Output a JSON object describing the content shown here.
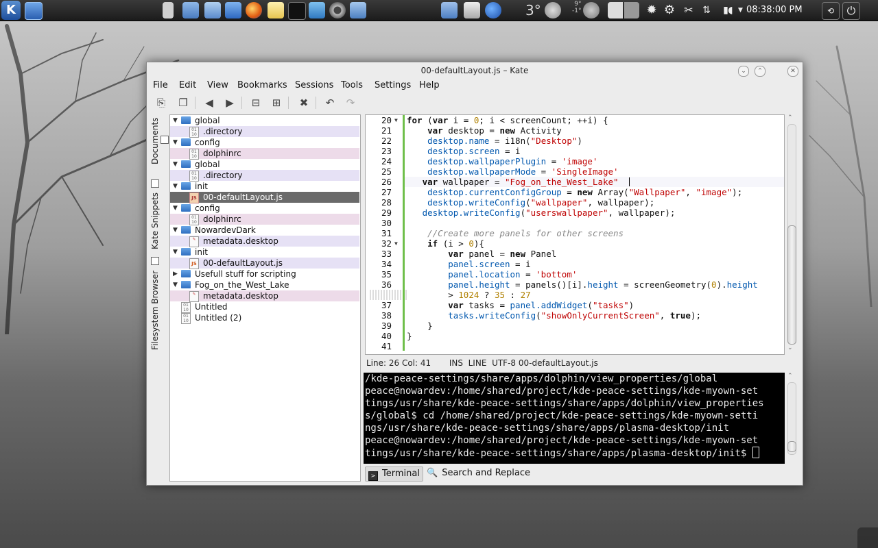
{
  "panel": {
    "clock": "08:38:00 PM",
    "weather_temp": "3°",
    "weather_high": "9°",
    "weather_low": "-1°",
    "launcher_icons": [
      "kde-menu-icon",
      "desktop-icon",
      "clipboard-icon",
      "bookmarks-icon",
      "search-icon",
      "dolphin-icon",
      "firefox-icon",
      "notes-icon",
      "konsole-icon",
      "kate-icon",
      "camera-icon",
      "settings-icon"
    ]
  },
  "window": {
    "title": "00-defaultLayout.js – Kate",
    "menus": [
      "File",
      "Edit",
      "View",
      "Bookmarks",
      "Sessions",
      "Tools",
      "Settings",
      "Help"
    ]
  },
  "side_tabs": [
    "Documents",
    "Kate Snippets",
    "Filesystem Browser"
  ],
  "file_tree": [
    {
      "label": "global",
      "type": "folder"
    },
    {
      "label": ".directory",
      "type": "file",
      "hl": "hl1"
    },
    {
      "label": "config",
      "type": "folder"
    },
    {
      "label": "dolphinrc",
      "type": "file",
      "hl": "hl2"
    },
    {
      "label": "global",
      "type": "folder"
    },
    {
      "label": ".directory",
      "type": "file",
      "hl": "hl1"
    },
    {
      "label": "init",
      "type": "folder"
    },
    {
      "label": "00-defaultLayout.js",
      "type": "js",
      "hl": "sel"
    },
    {
      "label": "config",
      "type": "folder"
    },
    {
      "label": "dolphinrc",
      "type": "file",
      "hl": "hl2"
    },
    {
      "label": "NowardevDark",
      "type": "folder"
    },
    {
      "label": "metadata.desktop",
      "type": "desktop",
      "hl": "hl1"
    },
    {
      "label": "init",
      "type": "folder"
    },
    {
      "label": "00-defaultLayout.js",
      "type": "js",
      "hl": "hl1"
    },
    {
      "label": "Usefull stuff for scripting",
      "type": "folder-collapsed"
    },
    {
      "label": "Fog_on_the_West_Lake",
      "type": "folder"
    },
    {
      "label": "metadata.desktop",
      "type": "desktop",
      "hl": "hl2"
    },
    {
      "label": "Untitled",
      "type": "untitled"
    },
    {
      "label": "Untitled (2)",
      "type": "untitled"
    }
  ],
  "editor": {
    "line_numbers": [
      "20",
      "21",
      "22",
      "23",
      "24",
      "25",
      "26",
      "27",
      "28",
      "29",
      "30",
      "31",
      "32",
      "33",
      "34",
      "35",
      "36",
      "",
      "37",
      "38",
      "39",
      "40",
      "41"
    ]
  },
  "status": {
    "position": "Line: 26 Col: 41",
    "mode": "INS",
    "selection": "LINE",
    "encoding": "UTF-8",
    "file": "00-defaultLayout.js"
  },
  "terminal": {
    "lines": [
      "/kde-peace-settings/share/apps/dolphin/view_properties/global",
      "peace@nowardev:/home/shared/project/kde-peace-settings/kde-myown-set",
      "tings/usr/share/kde-peace-settings/share/apps/dolphin/view_properties",
      "s/global$ cd /home/shared/project/kde-peace-settings/kde-myown-setti",
      "ngs/usr/share/kde-peace-settings/share/apps/plasma-desktop/init",
      "peace@nowardev:/home/shared/project/kde-peace-settings/kde-myown-set",
      "tings/usr/share/kde-peace-settings/share/apps/plasma-desktop/init$ "
    ]
  },
  "bottom_tabs": [
    "Terminal",
    "Search and Replace"
  ],
  "colors": {
    "keyword": "#111111",
    "string": "#bf0303",
    "number": "#b08000",
    "property": "#0057ae",
    "comment": "#888888",
    "modified_line": "#6fbf4a"
  }
}
